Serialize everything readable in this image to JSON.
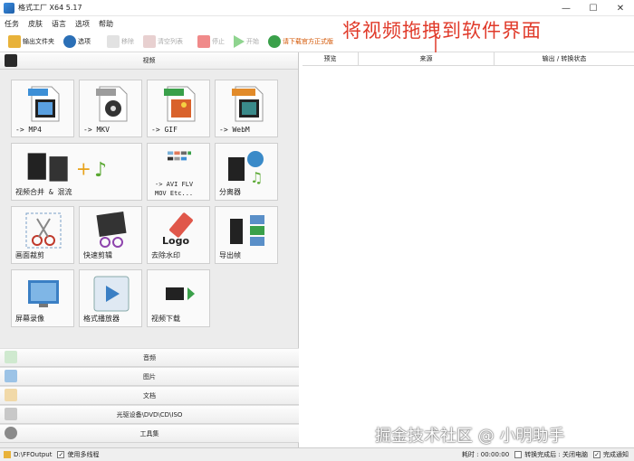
{
  "window": {
    "title": "格式工厂 X64 5.17",
    "minimize": "—",
    "maximize": "☐",
    "close": "✕"
  },
  "menu": [
    "任务",
    "皮肤",
    "语言",
    "选项",
    "帮助"
  ],
  "toolbar": {
    "output_folder": "输出文件夹",
    "options": "选项",
    "remove": "移除",
    "clear_list": "清空列表",
    "stop": "停止",
    "start": "开始",
    "download_link": "请下载官方正式版"
  },
  "annotation": "将视频拖拽到软件界面",
  "left": {
    "video_header": "视频",
    "tiles": [
      {
        "label": "-> MP4",
        "badge": "MP4",
        "badge_color": "#3d8fd6"
      },
      {
        "label": "-> MKV",
        "badge": "MKV",
        "badge_color": "#9c9c9c"
      },
      {
        "label": "-> GIF",
        "badge": "GIF",
        "badge_color": "#3aa04a"
      },
      {
        "label": "-> WebM",
        "badge": "WebM",
        "badge_color": "#e28b2a"
      },
      {
        "label": "视频合并 & 混流"
      },
      {
        "label": "-> AVI FLV\nMOV Etc..."
      },
      {
        "label": "分离器"
      },
      {
        "label": "画面裁剪"
      },
      {
        "label": "快速剪辑"
      },
      {
        "label": "去除水印"
      },
      {
        "label": "导出帧"
      },
      {
        "label": "屏幕录像"
      },
      {
        "label": "格式播放器"
      },
      {
        "label": "视频下载"
      }
    ],
    "categories": [
      "音频",
      "图片",
      "文档",
      "光驱设备\\DVD\\CD\\ISO",
      "工具集"
    ]
  },
  "right": {
    "columns": [
      "预览",
      "来源",
      "输出 / 转换状态"
    ]
  },
  "status": {
    "path": "D:\\FFOutput",
    "multithread": "使用多线程",
    "elapsed": "耗时 : 00:00:00",
    "after_done": "转换完成后 : 关闭电脑",
    "notify": "完成通知"
  },
  "watermark": "掘金技术社区 @ 小明助手",
  "colors": {
    "accent": "#e03a2a",
    "link": "#d35400"
  }
}
